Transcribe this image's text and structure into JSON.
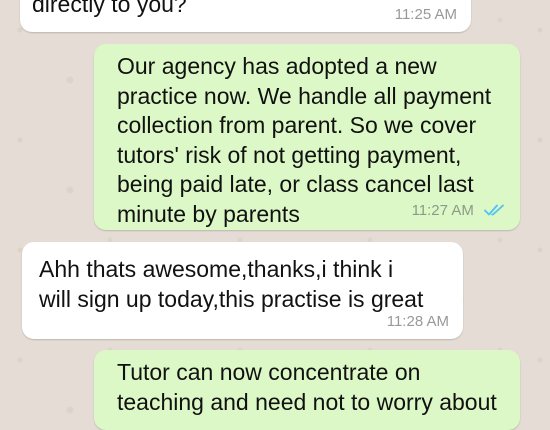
{
  "messages": [
    {
      "direction": "incoming",
      "text": "directly to you?",
      "time": "11:25 AM"
    },
    {
      "direction": "outgoing",
      "text": "Our agency has adopted a new\npractice now. We handle all payment\ncollection from parent. So we cover\ntutors' risk of not getting payment,\nbeing paid late, or class cancel last\nminute by parents",
      "time": "11:27 AM",
      "status": "read"
    },
    {
      "direction": "incoming",
      "text": "Ahh thats awesome,thanks,i think i\nwill sign up today,this practise is great",
      "time": "11:28 AM"
    },
    {
      "direction": "outgoing",
      "text": "Tutor can now concentrate on\nteaching and need not to worry about",
      "time": ""
    }
  ],
  "colors": {
    "chat_background": "#e5ddd5",
    "incoming_bubble": "#ffffff",
    "outgoing_bubble": "#dcf8c6",
    "read_ticks": "#4fc3f7",
    "timestamp": "#999999"
  },
  "icons": {
    "read_status": "double-check-icon"
  }
}
